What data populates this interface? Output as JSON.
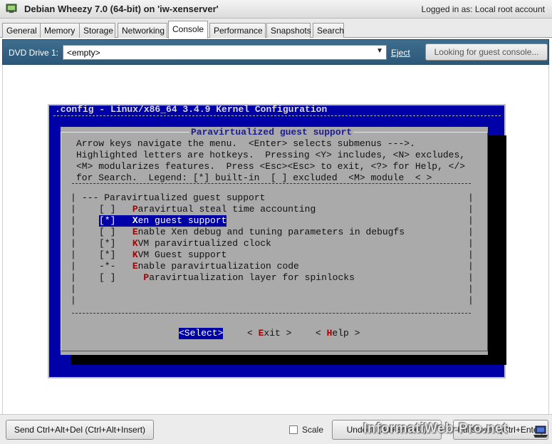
{
  "window": {
    "title": "Debian Wheezy 7.0 (64-bit) on 'iw-xenserver'",
    "login_status": "Logged in as:  Local root account"
  },
  "tabs": [
    {
      "label": "General"
    },
    {
      "label": "Memory"
    },
    {
      "label": "Storage"
    },
    {
      "label": "Networking"
    },
    {
      "label": "Console",
      "active": true
    },
    {
      "label": "Performance"
    },
    {
      "label": "Snapshots"
    },
    {
      "label": "Search"
    }
  ],
  "dvd": {
    "label": "DVD Drive 1:",
    "value": "<empty>",
    "eject": "Eject",
    "guest_console_button": "Looking for guest console..."
  },
  "terminal": {
    "header": ".config - Linux/x86_64 3.4.9 Kernel Configuration",
    "dialog_title": "Paravirtualized guest support",
    "help_lines": [
      "Arrow keys navigate the menu.  <Enter> selects submenus --->.",
      "Highlighted letters are hotkeys.  Pressing <Y> includes, <N> excludes,",
      "<M> modularizes features.  Press <Esc><Esc> to exit, <?> for Help, </>",
      "for Search.  Legend: [*] built-in  [ ] excluded  <M> module  < >"
    ],
    "menu": [
      {
        "text": "--- Paravirtualized guest support",
        "indent": 2
      },
      {
        "check": "[ ]",
        "hot": "P",
        "rest": "aravirtual steal time accounting"
      },
      {
        "check": "[*]",
        "hot": "X",
        "rest": "en guest support",
        "selected": true
      },
      {
        "check": "[ ]",
        "hot": "E",
        "rest": "nable Xen debug and tuning parameters in debugfs"
      },
      {
        "check": "[*]",
        "hot": "K",
        "rest": "VM paravirtualized clock"
      },
      {
        "check": "[*]",
        "hot": "K",
        "rest": "VM Guest support"
      },
      {
        "check": "-*-",
        "hot": "E",
        "rest": "nable paravirtualization code"
      },
      {
        "check": "[ ]",
        "hot": "P",
        "rest": "aravirtualization layer for spinlocks",
        "sub": true
      }
    ],
    "buttons": {
      "select": "<Select>",
      "exit_pre": "< ",
      "exit_hot": "E",
      "exit_rest": "xit >",
      "help_pre": "< ",
      "help_hot": "H",
      "help_rest": "elp >"
    }
  },
  "bottom": {
    "ctrl_alt_del": "Send Ctrl+Alt+Del (Ctrl+Alt+Insert)",
    "scale": "Scale",
    "undock": "Undock (Alt+Shift+U)",
    "fullscreen": "Fullscreen (Ctrl+Enter)",
    "watermark": "InformatiWeb-Pro.net"
  },
  "colors": {
    "terminal_bg": "#0000a8",
    "dialog_bg": "#aaaaaa",
    "hotkey": "#a80000",
    "dvd_bar": "#3e6d8e"
  }
}
